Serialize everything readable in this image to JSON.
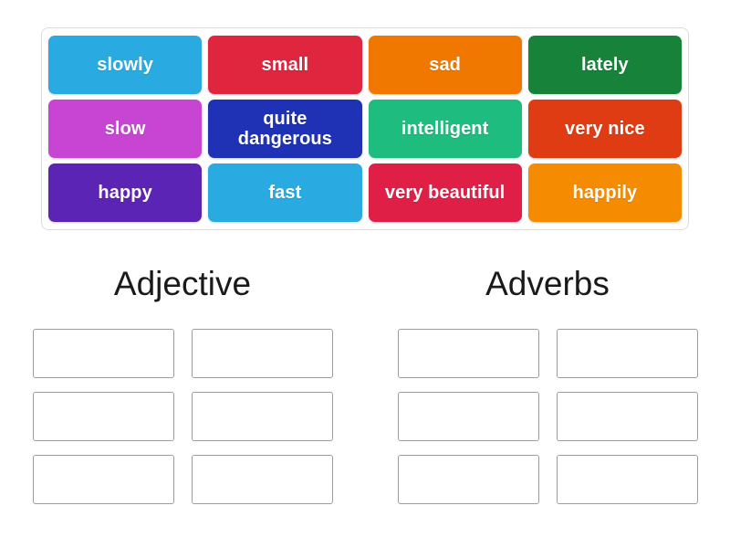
{
  "activity": {
    "type": "group-sort",
    "word_bank": {
      "tiles": [
        {
          "label": "slowly",
          "color": "#29ABE2"
        },
        {
          "label": "small",
          "color": "#E0253F"
        },
        {
          "label": "sad",
          "color": "#F07800"
        },
        {
          "label": "lately",
          "color": "#17833A"
        },
        {
          "label": "slow",
          "color": "#C845D4"
        },
        {
          "label": "quite dangerous",
          "color": "#1F32B5"
        },
        {
          "label": "intelligent",
          "color": "#1EBC7E"
        },
        {
          "label": "very nice",
          "color": "#E03C14"
        },
        {
          "label": "happy",
          "color": "#5C24B5"
        },
        {
          "label": "fast",
          "color": "#29ABE2"
        },
        {
          "label": "very beautiful",
          "color": "#E01F47"
        },
        {
          "label": "happily",
          "color": "#F58B00"
        }
      ]
    },
    "categories": [
      {
        "title": "Adjective",
        "slots": [
          "",
          "",
          "",
          "",
          "",
          ""
        ]
      },
      {
        "title": "Adverbs",
        "slots": [
          "",
          "",
          "",
          "",
          "",
          ""
        ]
      }
    ]
  }
}
